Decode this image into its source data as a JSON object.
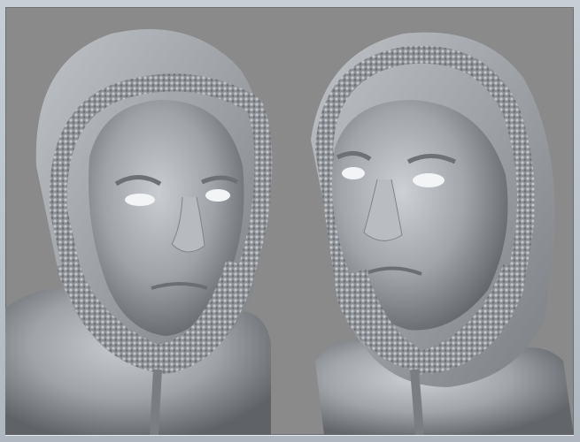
{
  "scene": {
    "description_colors": {
      "background": "#8a8a8a",
      "clay": "#9fa3a7",
      "clay_light": "#c9cdd1",
      "clay_dark": "#5f6368",
      "frame": "#b9c1c9"
    },
    "objects": [
      {
        "name": "left-bust",
        "icon": "sculpt-head-icon"
      },
      {
        "name": "right-bust",
        "icon": "sculpt-head-icon"
      }
    ]
  }
}
